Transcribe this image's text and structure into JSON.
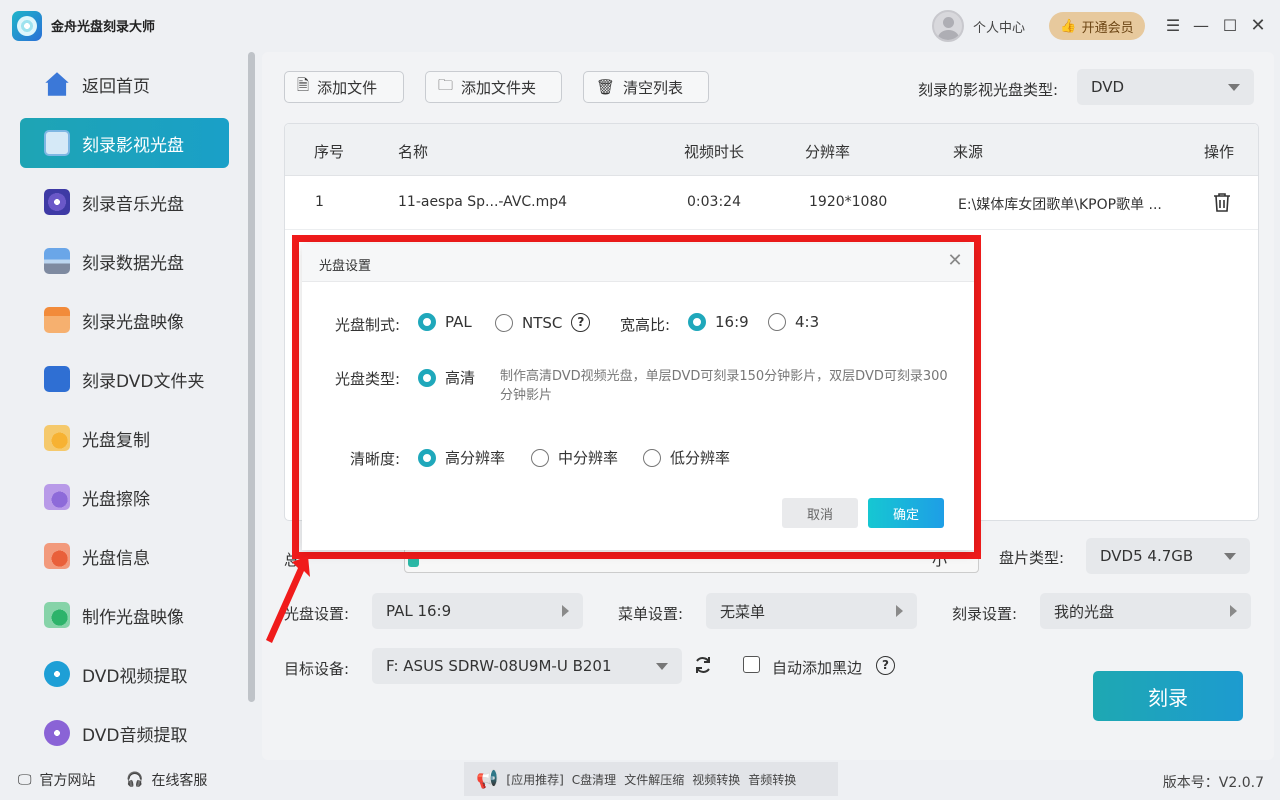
{
  "app": {
    "title": "金舟光盘刻录大师",
    "user_center": "个人中心",
    "vip": "开通会员",
    "version": "版本号：V2.0.7"
  },
  "colors": {
    "accent": "#1fa8bb",
    "highlight": "#f01b1b",
    "vip": "#e7c99d"
  },
  "sidebar": {
    "items": [
      {
        "label": "返回首页",
        "icon": "home-icon"
      },
      {
        "label": "刻录影视光盘",
        "icon": "video-disc-icon",
        "active": true
      },
      {
        "label": "刻录音乐光盘",
        "icon": "music-disc-icon"
      },
      {
        "label": "刻录数据光盘",
        "icon": "data-disc-icon"
      },
      {
        "label": "刻录光盘映像",
        "icon": "disc-image-icon"
      },
      {
        "label": "刻录DVD文件夹",
        "icon": "dvd-folder-icon"
      },
      {
        "label": "光盘复制",
        "icon": "disc-copy-icon"
      },
      {
        "label": "光盘擦除",
        "icon": "disc-erase-icon"
      },
      {
        "label": "光盘信息",
        "icon": "disc-info-icon"
      },
      {
        "label": "制作光盘映像",
        "icon": "make-image-icon"
      },
      {
        "label": "DVD视频提取",
        "icon": "dvd-video-extract-icon"
      },
      {
        "label": "DVD音频提取",
        "icon": "dvd-audio-extract-icon"
      }
    ]
  },
  "footer": {
    "website": "官方网站",
    "support": "在线客服",
    "promo": [
      "[应用推荐]",
      "C盘清理",
      "文件解压缩",
      "视频转换",
      "音频转换"
    ]
  },
  "toolbar": {
    "add_file": "添加文件",
    "add_folder": "添加文件夹",
    "clear_list": "清空列表",
    "disc_type_label": "刻录的影视光盘类型:",
    "disc_type_value": "DVD"
  },
  "table": {
    "headers": [
      "序号",
      "名称",
      "视频时长",
      "分辨率",
      "来源",
      "操作"
    ],
    "rows": [
      {
        "index": "1",
        "name": "11-aespa Sp...-AVC.mp4",
        "duration": "0:03:24",
        "resolution": "1920*1080",
        "source": "E:\\媒体库女团歌单\\KPOP歌单 ..."
      }
    ]
  },
  "bottom": {
    "total_label_partial": "总",
    "total_right_partial": "小",
    "media_type_label": "盘片类型:",
    "media_type_value": "DVD5 4.7GB",
    "disc_settings_label": "光盘设置:",
    "disc_settings_value": "PAL 16:9",
    "menu_settings_label": "菜单设置:",
    "menu_settings_value": "无菜单",
    "burn_settings_label": "刻录设置:",
    "burn_settings_value": "我的光盘",
    "target_label": "目标设备:",
    "target_value": "F: ASUS SDRW-08U9M-U B201",
    "auto_black_label": "自动添加黑边",
    "burn_button": "刻录",
    "progress_fraction": 0.02
  },
  "dialog": {
    "title": "光盘设置",
    "format_label": "光盘制式:",
    "format_options": [
      "PAL",
      "NTSC"
    ],
    "format_selected": "PAL",
    "ratio_label": "宽高比:",
    "ratio_options": [
      "16:9",
      "4:3"
    ],
    "ratio_selected": "16:9",
    "type_label": "光盘类型:",
    "type_option": "高清",
    "type_desc": "制作高清DVD视频光盘，单层DVD可刻录150分钟影片，双层DVD可刻录300分钟影片",
    "quality_label": "清晰度:",
    "quality_options": [
      "高分辨率",
      "中分辨率",
      "低分辨率"
    ],
    "quality_selected": "高分辨率",
    "cancel": "取消",
    "ok": "确定",
    "help_glyph": "?"
  }
}
